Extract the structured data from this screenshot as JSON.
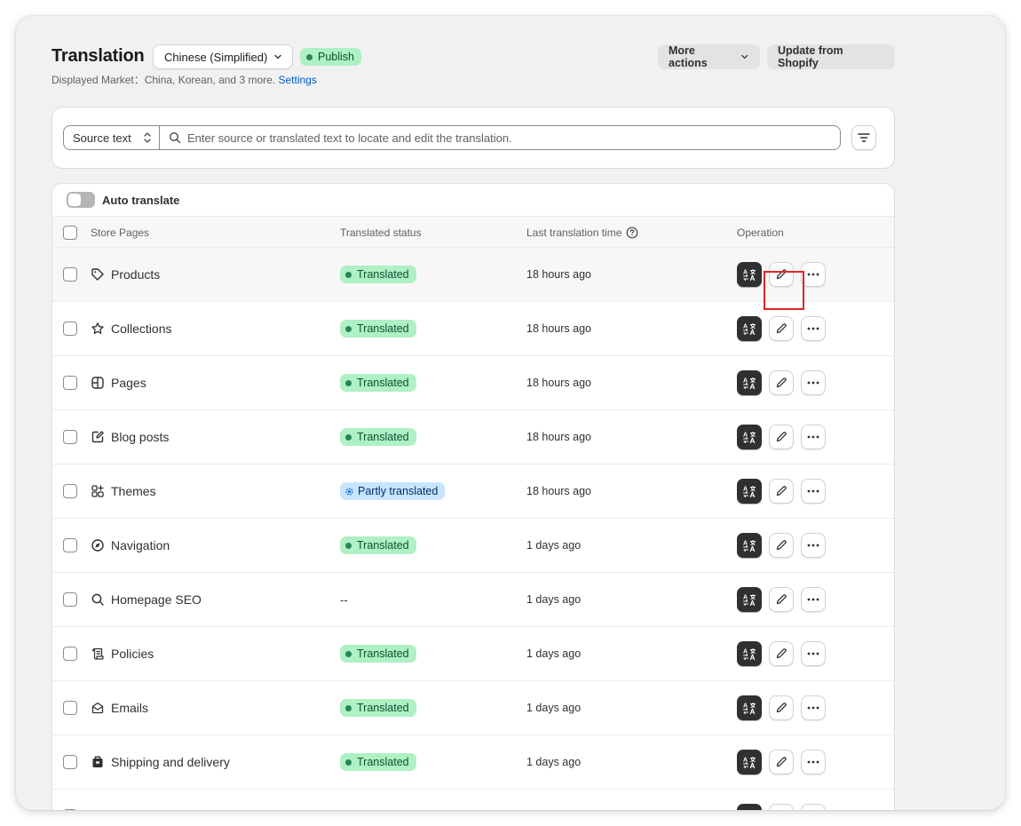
{
  "header": {
    "title": "Translation",
    "language": "Chinese (Simplified)",
    "publish_label": "Publish",
    "more_actions_label": "More actions",
    "update_label": "Update from Shopify",
    "displayed_market_text": "Displayed Market：China, Korean, and 3 more.",
    "settings_link": "Settings"
  },
  "search": {
    "source_select": "Source text",
    "placeholder": "Enter source or translated text to locate and edit the translation."
  },
  "table": {
    "auto_translate_label": "Auto translate",
    "columns": {
      "name": "Store Pages",
      "status": "Translated status",
      "time": "Last translation time",
      "operation": "Operation"
    },
    "rows": [
      {
        "name": "Products",
        "icon": "tag-icon",
        "status": "Translated",
        "status_type": "ok",
        "time": "18 hours ago"
      },
      {
        "name": "Collections",
        "icon": "star-icon",
        "status": "Translated",
        "status_type": "ok",
        "time": "18 hours ago"
      },
      {
        "name": "Pages",
        "icon": "layout-icon",
        "status": "Translated",
        "status_type": "ok",
        "time": "18 hours ago"
      },
      {
        "name": "Blog posts",
        "icon": "compose-icon",
        "status": "Translated",
        "status_type": "ok",
        "time": "18 hours ago"
      },
      {
        "name": "Themes",
        "icon": "apps-icon",
        "status": "Partly translated",
        "status_type": "partial",
        "time": "18 hours ago"
      },
      {
        "name": "Navigation",
        "icon": "compass-icon",
        "status": "Translated",
        "status_type": "ok",
        "time": "1 days ago"
      },
      {
        "name": "Homepage SEO",
        "icon": "search-icon",
        "status": "--",
        "status_type": "none",
        "time": "1 days ago"
      },
      {
        "name": "Policies",
        "icon": "policy-icon",
        "status": "Translated",
        "status_type": "ok",
        "time": "1 days ago"
      },
      {
        "name": "Emails",
        "icon": "email-icon",
        "status": "Translated",
        "status_type": "ok",
        "time": "1 days ago"
      },
      {
        "name": "Shipping and delivery",
        "icon": "delivery-icon",
        "status": "Translated",
        "status_type": "ok",
        "time": "1 days ago"
      },
      {
        "name": "",
        "icon": "",
        "status": "",
        "status_type": "none",
        "time": ""
      }
    ]
  },
  "colors": {
    "accent_link": "#005bd3",
    "success_bg": "#aff0c4",
    "partial_bg": "#c8e4ff",
    "highlight_box": "#e02424"
  }
}
